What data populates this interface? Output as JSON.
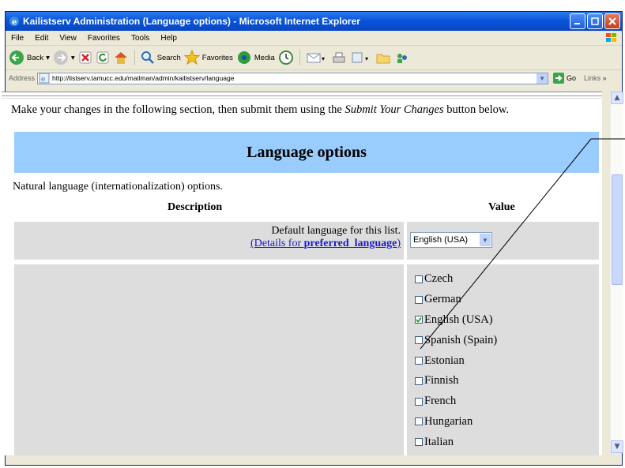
{
  "window": {
    "title": "Kailistserv Administration (Language options) - Microsoft Internet Explorer"
  },
  "menu": [
    "File",
    "Edit",
    "View",
    "Favorites",
    "Tools",
    "Help"
  ],
  "toolbar": {
    "back": "Back",
    "search": "Search",
    "favorites": "Favorites",
    "media": "Media"
  },
  "address": {
    "label": "Address",
    "url": "http://listserv.tamucc.edu/mailman/admin/kailistserv/language",
    "go": "Go",
    "links": "Links"
  },
  "page": {
    "intro_pre": "Make your changes in the following section, then submit them using the ",
    "intro_em": "Submit Your Changes",
    "intro_post": " button below.",
    "section_title": "Language options",
    "subtitle": "Natural language (internationalization) options.",
    "col_description": "Description",
    "col_value": "Value",
    "default_lang_label": "Default language for this list.",
    "details_pre": "(Details for ",
    "details_var": "preferred_language",
    "details_post": ")",
    "default_lang_value": "English (USA)",
    "languages": [
      {
        "label": "Czech",
        "checked": false
      },
      {
        "label": "German",
        "checked": false
      },
      {
        "label": "English (USA)",
        "checked": true
      },
      {
        "label": "Spanish (Spain)",
        "checked": false
      },
      {
        "label": "Estonian",
        "checked": false
      },
      {
        "label": "Finnish",
        "checked": false
      },
      {
        "label": "French",
        "checked": false
      },
      {
        "label": "Hungarian",
        "checked": false
      },
      {
        "label": "Italian",
        "checked": false
      }
    ]
  }
}
